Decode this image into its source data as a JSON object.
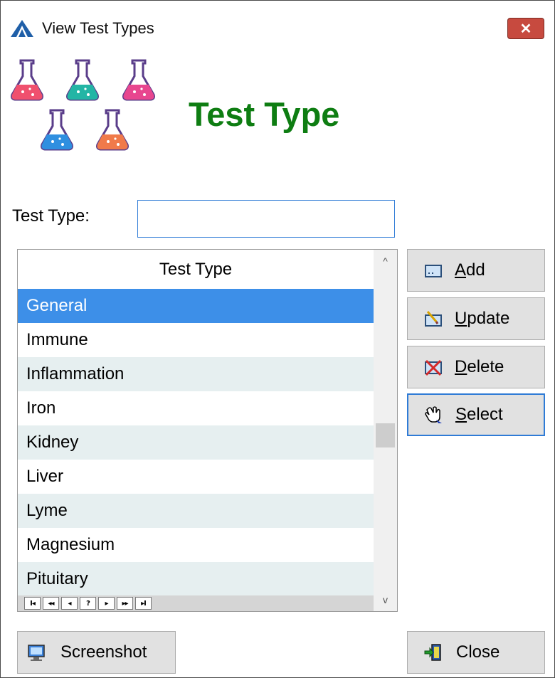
{
  "window": {
    "title": "View Test Types",
    "close_glyph": "✕"
  },
  "header": {
    "title": "Test Type",
    "logo_icon": "test-tube-flasks-icon"
  },
  "filter": {
    "label": "Test Type:",
    "value": "",
    "placeholder": ""
  },
  "grid": {
    "column_header": "Test Type",
    "rows": [
      "General",
      "Immune",
      "Inflammation",
      "Iron",
      "Kidney",
      "Liver",
      "Lyme",
      "Magnesium",
      "Pituitary"
    ],
    "selected_index": 0,
    "scroll_up": "^",
    "scroll_down": "v",
    "nav": [
      "I◂",
      "◂◂",
      "◂",
      "?",
      "▸",
      "▸▸",
      "▸I"
    ]
  },
  "buttons": {
    "add": {
      "mnemonic": "A",
      "rest": "dd",
      "icon": "add-record-icon"
    },
    "update": {
      "mnemonic": "U",
      "rest": "pdate",
      "icon": "edit-record-icon"
    },
    "delete": {
      "mnemonic": "D",
      "rest": "elete",
      "icon": "delete-record-icon"
    },
    "select": {
      "mnemonic": "S",
      "rest": "elect",
      "icon": "hand-pointer-icon"
    },
    "screenshot": {
      "label": "Screenshot",
      "icon": "monitor-icon"
    },
    "close": {
      "label": "Close",
      "icon": "exit-door-icon"
    }
  },
  "colors": {
    "title_green": "#0e7d12",
    "selection_blue": "#3d8fe8",
    "alt_row": "#e6eff0",
    "focus_border": "#2f7bd6"
  }
}
